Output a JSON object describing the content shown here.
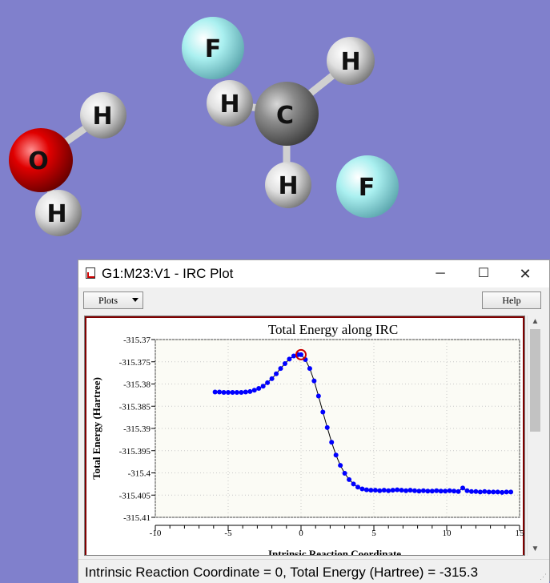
{
  "molecule": {
    "atoms": [
      {
        "element": "F",
        "color": "#aaf0f0"
      },
      {
        "element": "H",
        "color": "#e8e8e8"
      },
      {
        "element": "C",
        "color": "#8a8a8a"
      },
      {
        "element": "H",
        "color": "#e8e8e8"
      },
      {
        "element": "H",
        "color": "#e8e8e8"
      },
      {
        "element": "F",
        "color": "#aaf0f0"
      },
      {
        "element": "H",
        "color": "#e8e8e8"
      },
      {
        "element": "O",
        "color": "#e00000"
      },
      {
        "element": "H",
        "color": "#e8e8e8"
      }
    ],
    "background_color": "#8080cc"
  },
  "window": {
    "title": "G1:M23:V1 - IRC Plot",
    "controls": {
      "minimize": "─",
      "maximize": "☐",
      "close": "✕"
    }
  },
  "toolbar": {
    "plots_label": "Plots",
    "help_label": "Help"
  },
  "chart_data": {
    "type": "line",
    "title": "Total Energy along IRC",
    "xlabel": "Intrinsic Reaction Coordinate",
    "ylabel": "Total Energy (Hartree)",
    "xlim": [
      -10,
      15
    ],
    "ylim": [
      -315.41,
      -315.37
    ],
    "xticks": [
      "-10",
      "-5",
      "0",
      "5",
      "10",
      "15"
    ],
    "yticks": [
      "-315.37",
      "-315.375",
      "-315.38",
      "-315.385",
      "-315.39",
      "-315.395",
      "-315.4",
      "-315.405",
      "-315.41"
    ],
    "series": [
      {
        "color": "#0000ff",
        "x": [
          -5.9,
          -5.6,
          -5.3,
          -5.0,
          -4.7,
          -4.4,
          -4.1,
          -3.8,
          -3.5,
          -3.2,
          -2.9,
          -2.6,
          -2.3,
          -2.0,
          -1.7,
          -1.4,
          -1.1,
          -0.8,
          -0.5,
          -0.2,
          0.0,
          0.3,
          0.6,
          0.9,
          1.2,
          1.5,
          1.8,
          2.1,
          2.4,
          2.7,
          3.0,
          3.3,
          3.6,
          3.9,
          4.2,
          4.5,
          4.8,
          5.1,
          5.4,
          5.7,
          6.0,
          6.3,
          6.6,
          6.9,
          7.2,
          7.5,
          7.8,
          8.1,
          8.4,
          8.7,
          9.0,
          9.3,
          9.6,
          9.9,
          10.2,
          10.5,
          10.8,
          11.1,
          11.4,
          11.7,
          12.0,
          12.3,
          12.6,
          12.9,
          13.2,
          13.5,
          13.8,
          14.1,
          14.4
        ],
        "y": [
          -315.3818,
          -315.3818,
          -315.3819,
          -315.3819,
          -315.3819,
          -315.3819,
          -315.3819,
          -315.3818,
          -315.3817,
          -315.3814,
          -315.381,
          -315.3805,
          -315.3797,
          -315.3788,
          -315.3777,
          -315.3765,
          -315.3754,
          -315.3744,
          -315.3737,
          -315.3734,
          -315.3734,
          -315.3745,
          -315.3765,
          -315.3793,
          -315.3827,
          -315.3863,
          -315.3898,
          -315.3931,
          -315.396,
          -315.3983,
          -315.4001,
          -315.4015,
          -315.4025,
          -315.4032,
          -315.4036,
          -315.4038,
          -315.4039,
          -315.4039,
          -315.404,
          -315.4039,
          -315.404,
          -315.4039,
          -315.4038,
          -315.4039,
          -315.404,
          -315.4039,
          -315.404,
          -315.4041,
          -315.404,
          -315.4041,
          -315.4041,
          -315.404,
          -315.4041,
          -315.4041,
          -315.404,
          -315.4041,
          -315.4042,
          -315.4034,
          -315.404,
          -315.4042,
          -315.4042,
          -315.4043,
          -315.4042,
          -315.4043,
          -315.4043,
          -315.4043,
          -315.4044,
          -315.4043,
          -315.4043
        ]
      }
    ],
    "highlight": {
      "x": 0.0,
      "y": -315.3734,
      "color": "#cc0000"
    }
  },
  "status": {
    "text": "Intrinsic Reaction Coordinate = 0, Total Energy (Hartree) = -315.3"
  }
}
